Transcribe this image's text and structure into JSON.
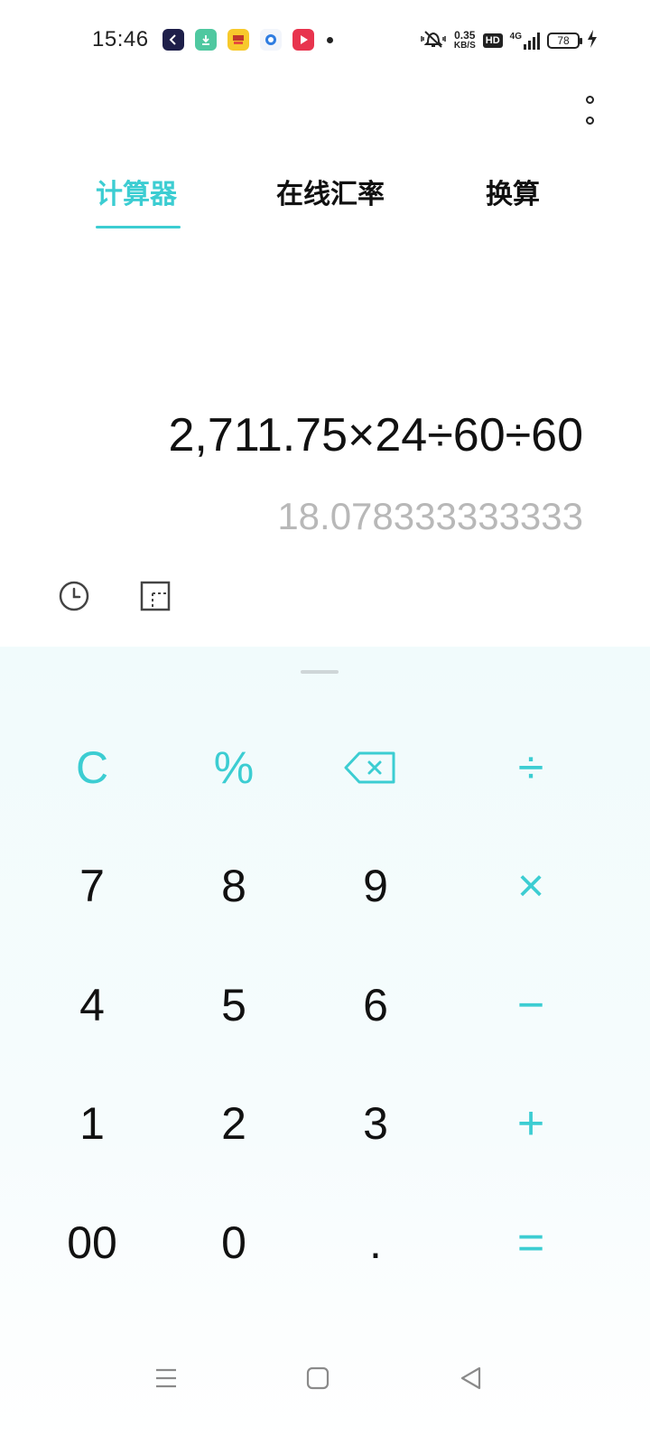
{
  "status_bar": {
    "time": "15:46",
    "app_icons": [
      "back-app-icon",
      "download-app-icon",
      "news-app-icon",
      "browser-app-icon",
      "video-app-icon"
    ],
    "net_speed_value": "0.35",
    "net_speed_unit": "KB/S",
    "hd_label": "HD",
    "network_type": "4G",
    "battery_level": "78"
  },
  "tabs": [
    {
      "label": "计算器",
      "active": true
    },
    {
      "label": "在线汇率",
      "active": false
    },
    {
      "label": "换算",
      "active": false
    }
  ],
  "display": {
    "expression": "2,711.75×24÷60÷60",
    "result": "18.078333333333"
  },
  "keypad": {
    "rows": [
      [
        "C",
        "%",
        "backspace",
        "÷"
      ],
      [
        "7",
        "8",
        "9",
        "×"
      ],
      [
        "4",
        "5",
        "6",
        "−"
      ],
      [
        "1",
        "2",
        "3",
        "+"
      ],
      [
        "00",
        "0",
        ".",
        "="
      ]
    ]
  },
  "colors": {
    "accent": "#3ccdd2",
    "text": "#111111",
    "result_text": "#b8b8b8",
    "keypad_bg": "#f1fbfc"
  }
}
